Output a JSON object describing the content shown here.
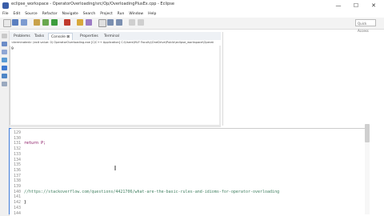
{
  "window": {
    "title": "eclipse_workspace - OperatorOverloading/src/Op/OverloadingPlusEx.cpp - Eclipse",
    "controls": {
      "minimize": "—",
      "maximize": "☐",
      "close": "✕"
    }
  },
  "menu": [
    "File",
    "Edit",
    "Source",
    "Refactor",
    "Navigate",
    "Search",
    "Project",
    "Run",
    "Window",
    "Help"
  ],
  "quick_access": "Quick Access",
  "tabs": [
    {
      "label": "Problems"
    },
    {
      "label": "Tasks"
    },
    {
      "label": "Console ⊠",
      "active": true
    },
    {
      "label": "Properties"
    },
    {
      "label": "Terminal"
    }
  ],
  "console": {
    "header": "<terminated> (exit value: 0) OperatorOverloading.exe [C/C++ Application] C:\\Users\\MLF Faculty\\OneDrive\\Public\\eclipse_workspace\\Operat",
    "output": "9"
  },
  "editor": {
    "line_numbers": [
      "129",
      "130",
      "131",
      "132",
      "133",
      "134",
      "135",
      "136",
      "137",
      "138",
      "139",
      "140",
      "141",
      "142",
      "143",
      "144"
    ],
    "lines": [
      {
        "text": "",
        "color": "#000"
      },
      {
        "text": "",
        "color": "#000"
      },
      {
        "text": "        return P;",
        "color": "#7f0055"
      },
      {
        "text": "",
        "color": "#000"
      },
      {
        "text": "",
        "color": "#000"
      },
      {
        "text": "",
        "color": "#000"
      },
      {
        "text": "",
        "color": "#000"
      },
      {
        "text": "",
        "color": "#000"
      },
      {
        "text": "",
        "color": "#000"
      },
      {
        "text": "",
        "color": "#000"
      },
      {
        "text": "",
        "color": "#000"
      },
      {
        "text": "    //https://stackoverflow.com/questions/4421706/what-are-the-basic-rules-and-idioms-for-operator-overloading",
        "color": "#3f7f5f"
      },
      {
        "text": "",
        "color": "#000"
      },
      {
        "text": "}",
        "color": "#000"
      },
      {
        "text": "",
        "color": "#000"
      },
      {
        "text": "",
        "color": "#000"
      }
    ]
  },
  "colors": {
    "keyword": "#7f0055",
    "comment": "#3f7f5f",
    "accent": "#3d7bd9"
  }
}
